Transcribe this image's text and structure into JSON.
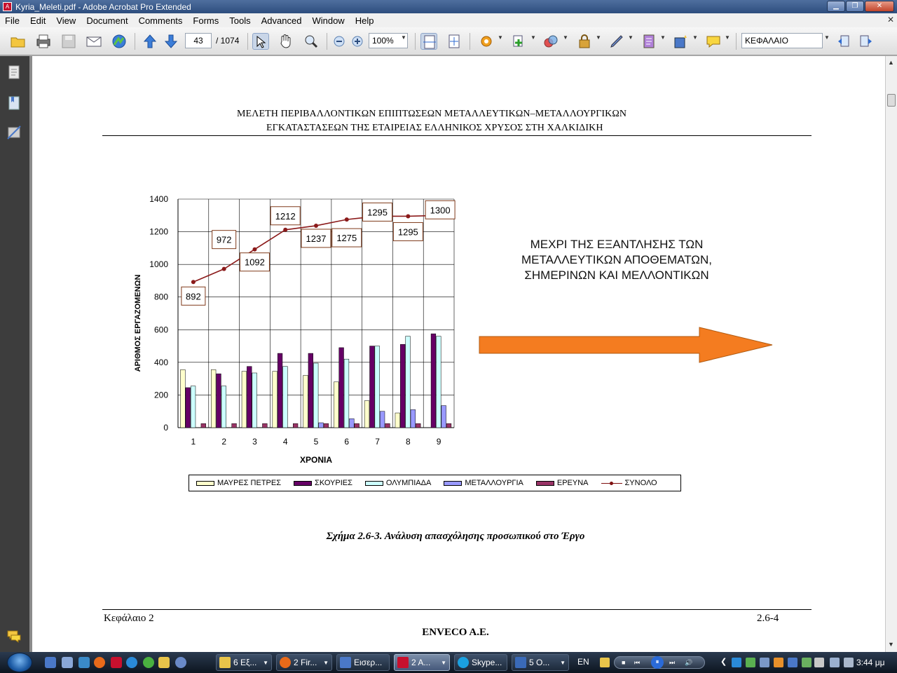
{
  "window": {
    "title": "Kyria_Meleti.pdf - Adobe Acrobat Pro Extended"
  },
  "menu": [
    "File",
    "Edit",
    "View",
    "Document",
    "Comments",
    "Forms",
    "Tools",
    "Advanced",
    "Window",
    "Help"
  ],
  "toolbar": {
    "page_current": "43",
    "page_total": "/ 1074",
    "zoom": "100%",
    "search_value": "ΚΕΦΑΛΑΙΟ"
  },
  "document": {
    "header_line1": "ΜΕΛΕΤΗ ΠΕΡΙΒΑΛΛΟΝΤΙΚΩΝ ΕΠΙΠΤΩΣΕΩΝ ΜΕΤΑΛΛΕΥΤΙΚΩΝ–ΜΕΤΑΛΛΟΥΡΓΙΚΩΝ",
    "header_line2": "ΕΓΚΑΤΑΣΤΑΣΕΩΝ ΤΗΣ ΕΤΑΙΡΕΙΑΣ ΕΛΛΗΝΙΚΟΣ ΧΡΥΣΟΣ ΣΤΗ ΧΑΛΚΙΔΙΚΗ",
    "note_lines": [
      "ΜΕΧΡΙ ΤΗΣ ΕΞΑΝΤΛΗΣΗΣ ΤΩΝ",
      "ΜΕΤΑΛΛΕΥΤΙΚΩΝ ΑΠΟΘΕΜΑΤΩΝ,",
      "ΣΗΜΕΡΙΝΩΝ ΚΑΙ ΜΕΛΛΟΝΤΙΚΩΝ"
    ],
    "caption": "Σχήμα 2.6-3. Ανάλυση απασχόλησης προσωπικού στο Έργο",
    "footer_left": "Κεφάλαιο 2",
    "footer_right": "2.6-4",
    "footer_center": "ENVECO A.E."
  },
  "chart_data": {
    "type": "bar",
    "categories": [
      "1",
      "2",
      "3",
      "4",
      "5",
      "6",
      "7",
      "8",
      "9"
    ],
    "xlabel": "ΧΡΟΝΙΑ",
    "ylabel": "ΑΡΙΘΜΟΣ ΕΡΓΑΖΟΜΕΝΩΝ",
    "ylim": [
      0,
      1400
    ],
    "yticks": [
      0,
      200,
      400,
      600,
      800,
      1000,
      1200,
      1400
    ],
    "grid": true,
    "legend_position": "bottom",
    "series": [
      {
        "name": "ΜΑΥΡΕΣ ΠΕΤΡΕΣ",
        "type": "bar",
        "color": "#ffffcc",
        "values": [
          355,
          355,
          345,
          345,
          320,
          280,
          165,
          90,
          0
        ]
      },
      {
        "name": "ΣΚΟΥΡΙΕΣ",
        "type": "bar",
        "color": "#660066",
        "values": [
          245,
          330,
          375,
          455,
          455,
          490,
          500,
          510,
          575
        ]
      },
      {
        "name": "ΟΛΥΜΠΙΑΔΑ",
        "type": "bar",
        "color": "#ccffff",
        "values": [
          255,
          255,
          335,
          375,
          395,
          420,
          500,
          560,
          560
        ]
      },
      {
        "name": "ΜΕΤΑΛΛΟΥΡΓΙΑ",
        "type": "bar",
        "color": "#9999ff",
        "values": [
          0,
          0,
          0,
          0,
          30,
          55,
          100,
          110,
          135
        ]
      },
      {
        "name": "ΕΡΕΥΝΑ",
        "type": "bar",
        "color": "#993366",
        "values": [
          25,
          25,
          25,
          25,
          25,
          25,
          25,
          25,
          25
        ]
      },
      {
        "name": "ΣΥΝΟΛΟ",
        "type": "line",
        "color": "#8b1a1a",
        "values": [
          892,
          972,
          1092,
          1212,
          1237,
          1275,
          1295,
          1295,
          1300
        ]
      }
    ],
    "data_labels": [
      "892",
      "972",
      "1092",
      "1212",
      "1237",
      "1275",
      "1295",
      "1295",
      "1300"
    ]
  },
  "taskbar": {
    "tasks": [
      {
        "label": "6 Εξ...",
        "color": "#e8c44a"
      },
      {
        "label": "2 Fir...",
        "color": "#e86a1a"
      },
      {
        "label": "Εισερ...",
        "color": "#4a78c8"
      },
      {
        "label": "2 A...",
        "color": "#c8102e"
      },
      {
        "label": "Skype...",
        "color": "#1aa0e0"
      },
      {
        "label": "5 O...",
        "color": "#3a6ab8"
      }
    ],
    "language": "EN",
    "clock": "3:44 μμ"
  }
}
